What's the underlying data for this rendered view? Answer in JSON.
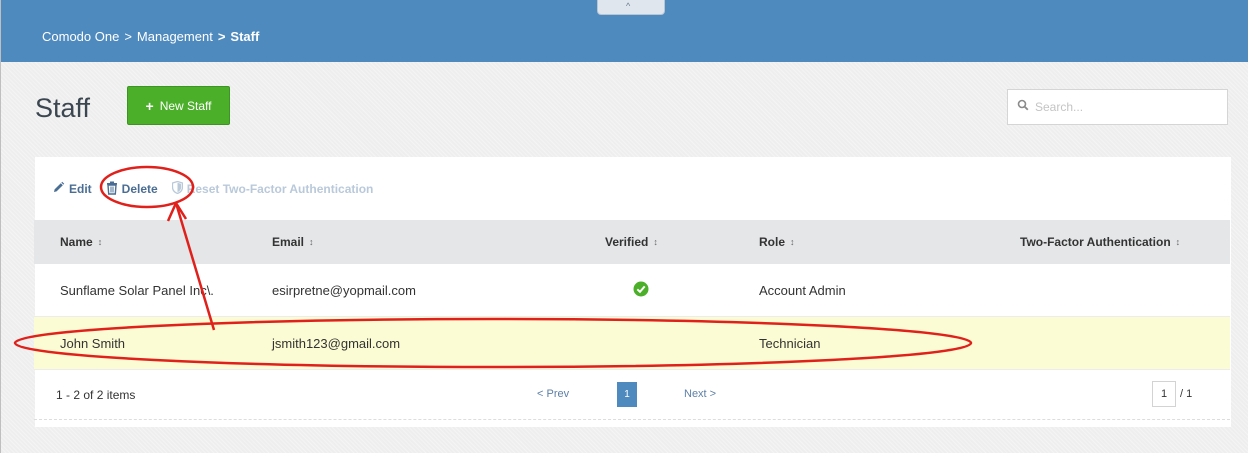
{
  "breadcrumb": {
    "root": "Comodo One",
    "sep": ">",
    "section": "Management",
    "current": "Staff"
  },
  "collapse_glyph": "^",
  "page": {
    "title": "Staff",
    "new_button": "New Staff"
  },
  "search": {
    "placeholder": "Search..."
  },
  "toolbar": {
    "edit": "Edit",
    "delete": "Delete",
    "reset_2fa": "Reset Two-Factor Authentication"
  },
  "table": {
    "headers": {
      "name": "Name",
      "email": "Email",
      "verified": "Verified",
      "role": "Role",
      "twofa": "Two-Factor Authentication"
    },
    "sort_glyph": "↕",
    "rows": [
      {
        "name": "Sunflame Solar Panel Inc\\.",
        "email": "esirpretne@yopmail.com",
        "verified": true,
        "role": "Account Admin",
        "twofa": ""
      },
      {
        "name": "John Smith",
        "email": "jsmith123@gmail.com",
        "verified": false,
        "role": "Technician",
        "twofa": ""
      }
    ]
  },
  "pagination": {
    "summary": "1 - 2 of 2 items",
    "prev": "< Prev",
    "current": "1",
    "next": "Next >",
    "page_input": "1",
    "total": "/ 1"
  },
  "colors": {
    "header_blue": "#4f8abf",
    "new_button_green": "#4caf2a",
    "annotation_red": "#e0201b",
    "selected_row": "#fbfbd4"
  },
  "icons": {
    "new": "plus-icon",
    "search": "search-icon",
    "edit": "pencil-icon",
    "delete": "trash-icon",
    "reset": "shield-icon",
    "verified": "check-circle-icon"
  }
}
